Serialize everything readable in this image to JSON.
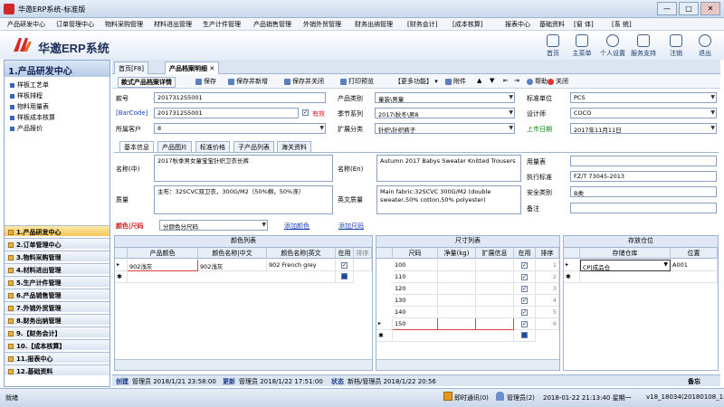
{
  "window": {
    "title": "华邀ERP系统-标准版",
    "min": "—",
    "max": "□",
    "close": "✕"
  },
  "menu": [
    "产品研发中心",
    "订单管理中心",
    "物料采购管理",
    "材料进出管理",
    "生产计件管理",
    "产品销售管理",
    "外销外贸管理",
    "财务出纳管理",
    "[财务会计]",
    "[成本核算]",
    "报表中心",
    "基础资料",
    "[窗 体]",
    "[系 统]"
  ],
  "brand": "华邀ERP系统",
  "topbtns": [
    "首页",
    "主菜单",
    "个人设置",
    "服务支持",
    "注销",
    "退出"
  ],
  "sidebar": {
    "title": "1.产品研发中心",
    "items": [
      "样板工艺单",
      "样板排程",
      "物料用量表",
      "样板成本核算",
      "产品报价"
    ],
    "modules": [
      "1.产品研发中心",
      "2.订单管理中心",
      "3.物料采购管理",
      "4.材料进出管理",
      "5.生产计件管理",
      "6.产品销售管理",
      "7.外销外贸管理",
      "8.财务出纳管理",
      "9.【财务会计】",
      "10.【成本核算】",
      "11.报表中心",
      "12.基础资料"
    ]
  },
  "doctabs": [
    "首页[F8]",
    "产品档案明细 ✕"
  ],
  "toolbar": [
    "款式产品档案详情",
    "保存",
    "保存并新增",
    "保存并关闭",
    "打印预览",
    "【更多功能】",
    "附件",
    "帮助",
    "关闭"
  ],
  "form": {
    "code_label": "款号",
    "code": "2017312S5001",
    "barcode_label": "[BarCode]",
    "barcode": "2017312S5001",
    "valid": "有效",
    "client_label": "所属客户",
    "client": "8",
    "category_label": "产品类别",
    "category": "童装\\男童",
    "season_label": "季节系列",
    "season": "2017\\秋冬\\男8",
    "ext_label": "扩展分类",
    "ext": "针织\\针织裤子",
    "unit_label": "标准单位",
    "unit": "PCS",
    "designer_label": "设计师",
    "designer": "COCO",
    "launch_label": "上市日期",
    "launch": "2017年11月11日"
  },
  "subtabs": [
    "基本信息",
    "产品图片",
    "标准价格",
    "子产品列表",
    "海关资料"
  ],
  "detail": {
    "name_cn_label": "名称(中)",
    "name_cn": "2017秋季男女童宝宝针织卫衣长裤",
    "name_en_label": "名称(En)",
    "name_en": "Autumn 2017 Babys Sweater Knitted Trousers",
    "quality_label": "质量",
    "quality": "主布：32SCVC双卫衣，300G/M2（50%棉，50%涤）",
    "quality_en_label": "英文质量",
    "quality_en": "Main fabric:32SCVC 300G/M2 (double sweater,50% cotton,50% polyester)",
    "wash_label": "用量表",
    "standard_label": "执行标准",
    "standard": "FZ/T 73045-2013",
    "safety_label": "安全类别",
    "safety": "B类",
    "remark_label": "备注"
  },
  "colorsize": {
    "label": "颜色|尺码",
    "select": "分颜色分尺码",
    "add_color": "添加颜色",
    "add_size": "添加尺码"
  },
  "colors": {
    "title": "颜色列表",
    "headers": [
      "产品颜色",
      "颜色名称|中文",
      "颜色名称|英文",
      "在用",
      "排序"
    ],
    "rows": [
      [
        "902浅灰",
        "902浅灰",
        "902 French grey",
        "✓",
        ""
      ]
    ]
  },
  "sizes": {
    "title": "尺寸列表",
    "headers": [
      "尺码",
      "净量(kg)",
      "扩展信息",
      "在用",
      "排序"
    ],
    "rows": [
      [
        "100",
        "",
        "",
        "✓",
        "1"
      ],
      [
        "110",
        "",
        "",
        "✓",
        "2"
      ],
      [
        "120",
        "",
        "",
        "✓",
        "3"
      ],
      [
        "130",
        "",
        "",
        "✓",
        "4"
      ],
      [
        "140",
        "",
        "",
        "✓",
        "5"
      ],
      [
        "150",
        "",
        "",
        "✓",
        "6"
      ]
    ]
  },
  "stock": {
    "title": "存放仓位",
    "headers": [
      "存储仓库",
      "位置"
    ],
    "rows": [
      [
        "CP|成品仓",
        "A001"
      ]
    ]
  },
  "status": {
    "create_label": "创建",
    "create": "管理员 2018/1/21 23:58:00",
    "update_label": "更新",
    "update": "管理员 2018/1/22 17:51:00",
    "state_label": "状态",
    "state": "新档/管理员 2018/1/22 20:56",
    "memo": "备忘"
  },
  "bottom": {
    "left": "就绪",
    "im": "即时通讯(0)",
    "user": "管理员(2)",
    "datetime": "2018-01-22 21:13:40 星期一",
    "version": "v18_18034(20180108_15)"
  }
}
